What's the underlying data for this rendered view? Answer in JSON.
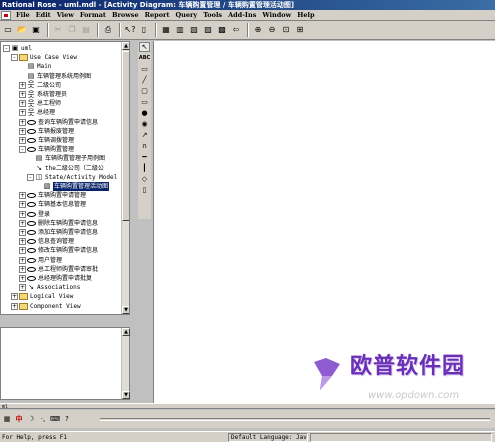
{
  "window": {
    "title": "Rational Rose - uml.mdl - [Activity Diagram: 车辆购置管理 / 车辆购置管理活动图]"
  },
  "menu": {
    "items": [
      "File",
      "Edit",
      "View",
      "Format",
      "Browse",
      "Report",
      "Query",
      "Tools",
      "Add-Ins",
      "Window",
      "Help"
    ]
  },
  "toolbar": {
    "buttons": [
      "new-icon",
      "open-icon",
      "save-icon",
      "cut-icon",
      "copy-icon",
      "paste-icon",
      "print-icon",
      "context-help-icon",
      "view-doc-icon",
      "browse-class-icon",
      "browse-interaction-icon",
      "browse-component-icon",
      "browse-deployment-icon",
      "browse-parent-icon",
      "browse-previous-icon",
      "zoom-in-icon",
      "zoom-out-icon",
      "fit-window-icon",
      "undo-fit-icon"
    ]
  },
  "browser": {
    "items": [
      {
        "label": "uml",
        "level": 0,
        "expander": "-",
        "icon": "model-icon"
      },
      {
        "label": "Use Case View",
        "level": 1,
        "expander": "-",
        "icon": "folder-icon"
      },
      {
        "label": "Main",
        "level": 2,
        "expander": "",
        "icon": "usecase-diagram-icon"
      },
      {
        "label": "车辆管理系统用例图",
        "level": 2,
        "expander": "",
        "icon": "usecase-diagram-icon"
      },
      {
        "label": "二级公司",
        "level": 2,
        "expander": "+",
        "icon": "actor-icon"
      },
      {
        "label": "系统管理员",
        "level": 2,
        "expander": "+",
        "icon": "actor-icon"
      },
      {
        "label": "总工程师",
        "level": 2,
        "expander": "+",
        "icon": "actor-icon"
      },
      {
        "label": "总经理",
        "level": 2,
        "expander": "+",
        "icon": "actor-icon"
      },
      {
        "label": "查询车辆购置申请信息",
        "level": 2,
        "expander": "+",
        "icon": "usecase-icon"
      },
      {
        "label": "车辆报废管理",
        "level": 2,
        "expander": "+",
        "icon": "usecase-icon"
      },
      {
        "label": "车辆调拨管理",
        "level": 2,
        "expander": "+",
        "icon": "usecase-icon"
      },
      {
        "label": "车辆购置管理",
        "level": 2,
        "expander": "-",
        "icon": "usecase-icon"
      },
      {
        "label": "车辆购置管理子用例图",
        "level": 3,
        "expander": "",
        "icon": "usecase-diagram-icon"
      },
      {
        "label": "the二级公司（二级公",
        "level": 3,
        "expander": "",
        "icon": "association-icon"
      },
      {
        "label": "State/Activity Model",
        "level": 3,
        "expander": "-",
        "icon": "activity-model-icon"
      },
      {
        "label": "车辆购置管理活动图",
        "level": 4,
        "expander": "",
        "icon": "activity-diagram-icon",
        "selected": true
      },
      {
        "label": "车辆购置申请管理",
        "level": 2,
        "expander": "+",
        "icon": "usecase-icon"
      },
      {
        "label": "车辆基本信息管理",
        "level": 2,
        "expander": "+",
        "icon": "usecase-icon"
      },
      {
        "label": "登录",
        "level": 2,
        "expander": "+",
        "icon": "usecase-icon"
      },
      {
        "label": "删除车辆购置申请信息",
        "level": 2,
        "expander": "+",
        "icon": "usecase-icon"
      },
      {
        "label": "添加车辆购置申请信息",
        "level": 2,
        "expander": "+",
        "icon": "usecase-icon"
      },
      {
        "label": "信息查询管理",
        "level": 2,
        "expander": "+",
        "icon": "usecase-icon"
      },
      {
        "label": "修改车辆购置申请信息",
        "level": 2,
        "expander": "+",
        "icon": "usecase-icon"
      },
      {
        "label": "用户管理",
        "level": 2,
        "expander": "+",
        "icon": "usecase-icon"
      },
      {
        "label": "总工程师购置申请审批",
        "level": 2,
        "expander": "+",
        "icon": "usecase-icon"
      },
      {
        "label": "总经理购置申请批复",
        "level": 2,
        "expander": "+",
        "icon": "usecase-icon"
      },
      {
        "label": "Associations",
        "level": 2,
        "expander": "+",
        "icon": "association-icon"
      },
      {
        "label": "Logical View",
        "level": 1,
        "expander": "+",
        "icon": "folder-icon"
      },
      {
        "label": "Component View",
        "level": 1,
        "expander": "+",
        "icon": "folder-icon"
      }
    ]
  },
  "diagram_toolbar": {
    "tools": [
      "selection-icon",
      "text-box-icon",
      "note-icon",
      "anchor-note-icon",
      "activity-icon",
      "state-icon",
      "start-state-icon",
      "end-state-icon",
      "transition-icon",
      "self-transition-icon",
      "horizontal-sync-icon",
      "vertical-sync-icon",
      "decision-icon",
      "swimlane-icon"
    ]
  },
  "watermark": {
    "text": "欧普软件园",
    "url": "www.opdown.com"
  },
  "log": {
    "label": "ml"
  },
  "status": {
    "help": "For Help, press F1",
    "language": "Default Language: Java"
  }
}
